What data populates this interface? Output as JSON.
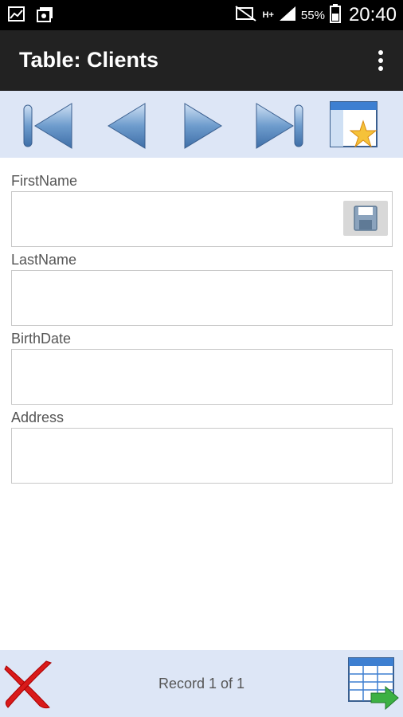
{
  "status_bar": {
    "battery_percent": "55%",
    "time": "20:40",
    "network": "H+"
  },
  "action_bar": {
    "title": "Table: Clients"
  },
  "navigation": {
    "buttons": [
      "first-record",
      "previous-record",
      "next-record",
      "last-record",
      "new-record"
    ]
  },
  "form": {
    "fields": [
      {
        "label": "FirstName",
        "value": ""
      },
      {
        "label": "LastName",
        "value": ""
      },
      {
        "label": "BirthDate",
        "value": ""
      },
      {
        "label": "Address",
        "value": ""
      }
    ]
  },
  "footer": {
    "record_status": "Record 1 of 1"
  }
}
